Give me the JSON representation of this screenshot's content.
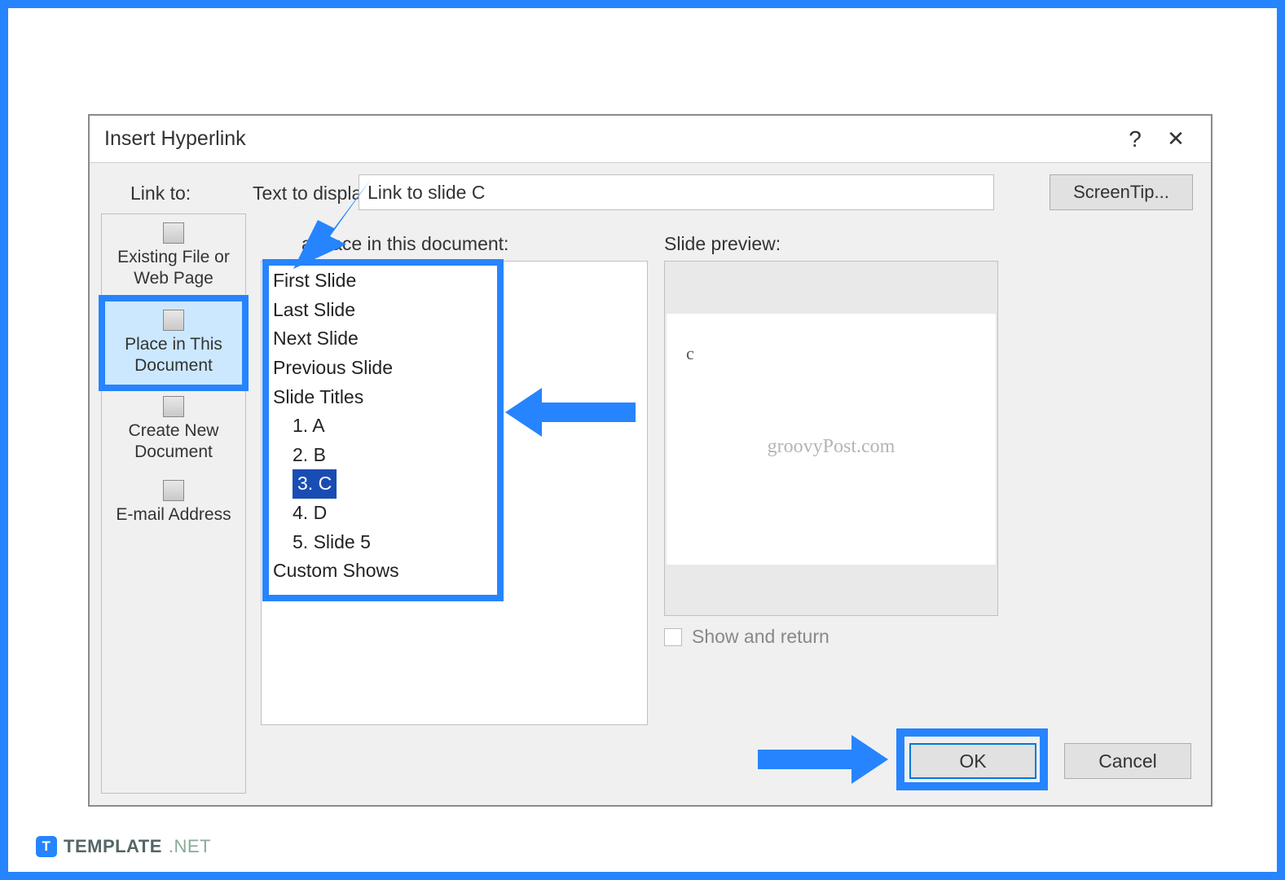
{
  "dialog": {
    "title": "Insert Hyperlink",
    "help": "?",
    "close": "✕",
    "link_to_label": "Link to:",
    "text_display_label": "Text to display:",
    "text_display_value": "Link to slide C",
    "screentip_label": "ScreenTip..."
  },
  "sidebar": {
    "items": [
      {
        "label": "Existing File or Web Page"
      },
      {
        "label": "Place in This Document"
      },
      {
        "label": "Create New Document"
      },
      {
        "label": "E-mail Address"
      }
    ]
  },
  "place_section": {
    "label": "a place in this document:",
    "tree": [
      "First Slide",
      "Last Slide",
      "Next Slide",
      "Previous Slide",
      "Slide Titles",
      "1. A",
      "2. B",
      "3. C",
      "4. D",
      "5. Slide 5",
      "Custom Shows"
    ],
    "selected_index": 7
  },
  "preview": {
    "label": "Slide preview:",
    "slide_letter": "c",
    "watermark": "groovyPost.com",
    "show_return_label": "Show and return"
  },
  "buttons": {
    "ok": "OK",
    "cancel": "Cancel"
  },
  "brand": {
    "logo_letter": "T",
    "name": "TEMPLATE",
    "suffix": ".NET"
  }
}
